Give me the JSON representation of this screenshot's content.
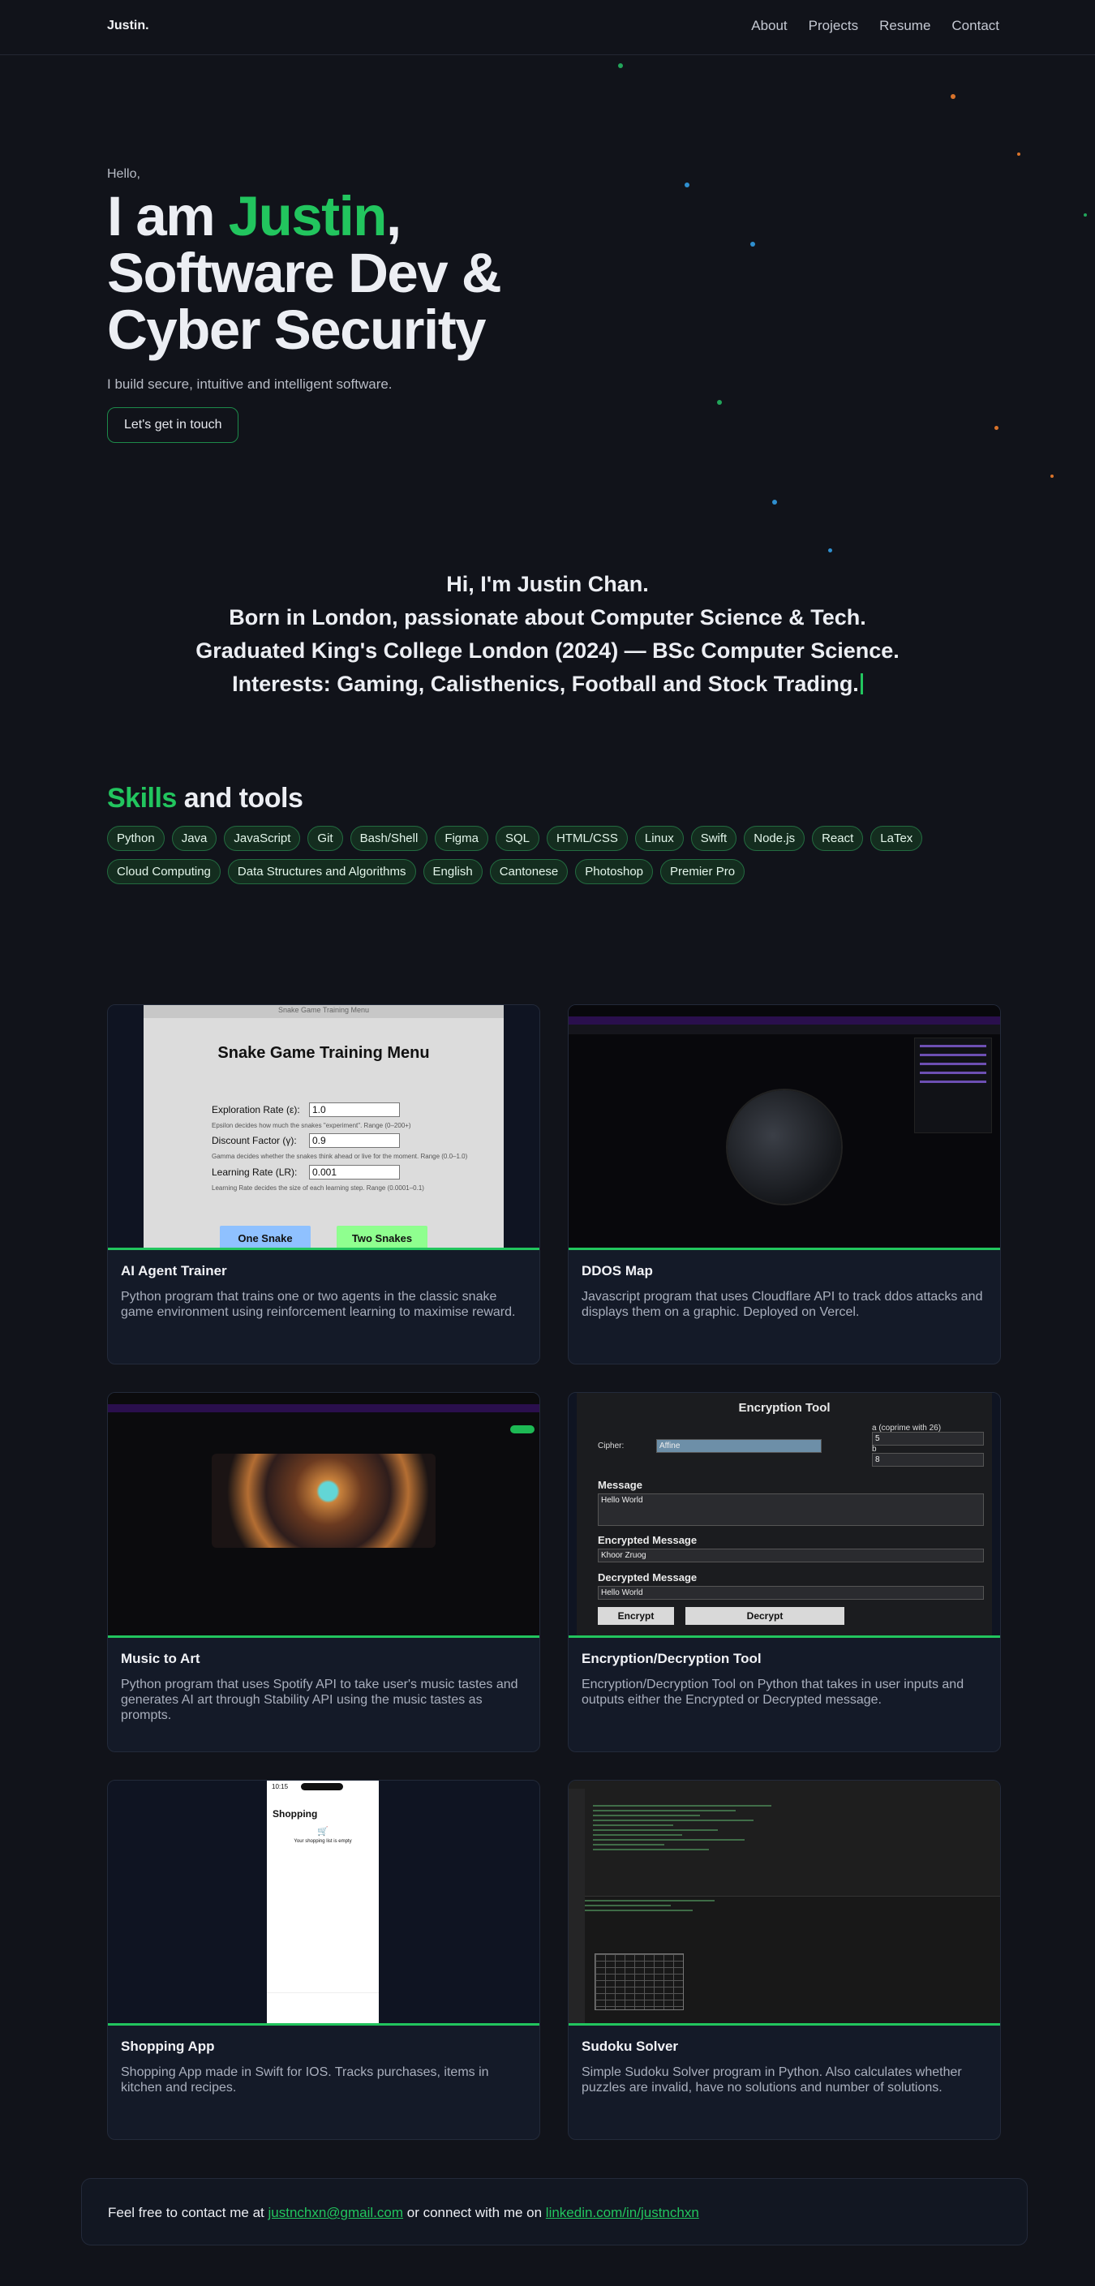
{
  "header": {
    "brand": "Justin",
    "brand_dot": ".",
    "nav": [
      "About",
      "Projects",
      "Resume",
      "Contact"
    ]
  },
  "hero": {
    "greeting": "Hello,",
    "title_prefix": "I am ",
    "title_name": "Justin",
    "title_comma": ",",
    "title_line2": "Software Dev &",
    "title_line3": "Cyber Security",
    "subtitle": "I build secure, intuitive and intelligent software.",
    "cta": "Let's get in touch"
  },
  "intro": [
    "Hi, I'm Justin Chan.",
    "Born in London, passionate about Computer Science & Tech.",
    "Graduated King's College London (2024) — BSc Computer Science.",
    "Interests: Gaming, Calisthenics, Football and Stock Trading."
  ],
  "skills": {
    "title_accent": "Skills",
    "title_rest": " and tools",
    "items": [
      "Python",
      "Java",
      "JavaScript",
      "Git",
      "Bash/Shell",
      "Figma",
      "SQL",
      "HTML/CSS",
      "Linux",
      "Swift",
      "Node.js",
      "React",
      "LaTex",
      "Cloud Computing",
      "Data Structures and Algorithms",
      "English",
      "Cantonese",
      "Photoshop",
      "Premier Pro"
    ]
  },
  "projects": [
    {
      "title": "AI Agent Trainer",
      "desc": "Python program that trains one or two agents in the classic snake game environment using reinforcement learning to maximise reward.",
      "shot": {
        "window_title": "Snake Game Training Menu",
        "heading": "Snake Game Training Menu",
        "fields": [
          {
            "label": "Exploration Rate (ε):",
            "value": "1.0",
            "hint": "Epsilon decides how much the snakes \"experiment\". Range (0–200+)"
          },
          {
            "label": "Discount Factor (γ):",
            "value": "0.9",
            "hint": "Gamma decides whether the snakes think ahead or live for the moment. Range (0.0–1.0)"
          },
          {
            "label": "Learning Rate (LR):",
            "value": "0.001",
            "hint": "Learning Rate decides the size of each learning step. Range (0.0001–0.1)"
          }
        ],
        "buttons": [
          "One Snake",
          "Two Snakes"
        ]
      }
    },
    {
      "title": "DDOS Map",
      "desc": "Javascript program that uses Cloudflare API to track ddos attacks and displays them on a graphic. Deployed on Vercel."
    },
    {
      "title": "Music to Art",
      "desc": "Python program that uses Spotify API to take user's music tastes and generates AI art through Stability API using the music tastes as prompts."
    },
    {
      "title": "Encryption/Decryption Tool",
      "desc": "Encryption/Decryption Tool on Python that takes in user inputs and outputs either the Encrypted or Decrypted message.",
      "shot": {
        "heading": "Encryption Tool",
        "cipher_label": "Cipher:",
        "cipher_value": "Affine",
        "a_label": "a (coprime with 26)",
        "a_value": "5",
        "b_label": "b",
        "b_value": "8",
        "message_label": "Message",
        "message_value": "Hello World",
        "encrypted_label": "Encrypted Message",
        "encrypted_value": "Khoor Zruog",
        "decrypted_label": "Decrypted Message",
        "decrypted_value": "Hello World",
        "buttons": [
          "Encrypt",
          "Decrypt"
        ]
      }
    },
    {
      "title": "Shopping App",
      "desc": "Shopping App made in Swift for IOS. Tracks purchases, items in kitchen and recipes.",
      "shot": {
        "time": "10:15",
        "heading": "Shopping",
        "empty": "Your shopping list is empty"
      }
    },
    {
      "title": "Sudoku Solver",
      "desc": "Simple Sudoku Solver program in Python. Also calculates whether puzzles are invalid, have no solutions and number of solutions."
    }
  ],
  "contact": {
    "prefix": "Feel free to contact me at ",
    "email": "justnchxn@gmail.com",
    "middle": " or connect with me on ",
    "linkedin": "linkedin.com/in/justnchxn"
  },
  "colors": {
    "accent": "#22c55e",
    "background": "#11131a",
    "card": "#141a28"
  }
}
